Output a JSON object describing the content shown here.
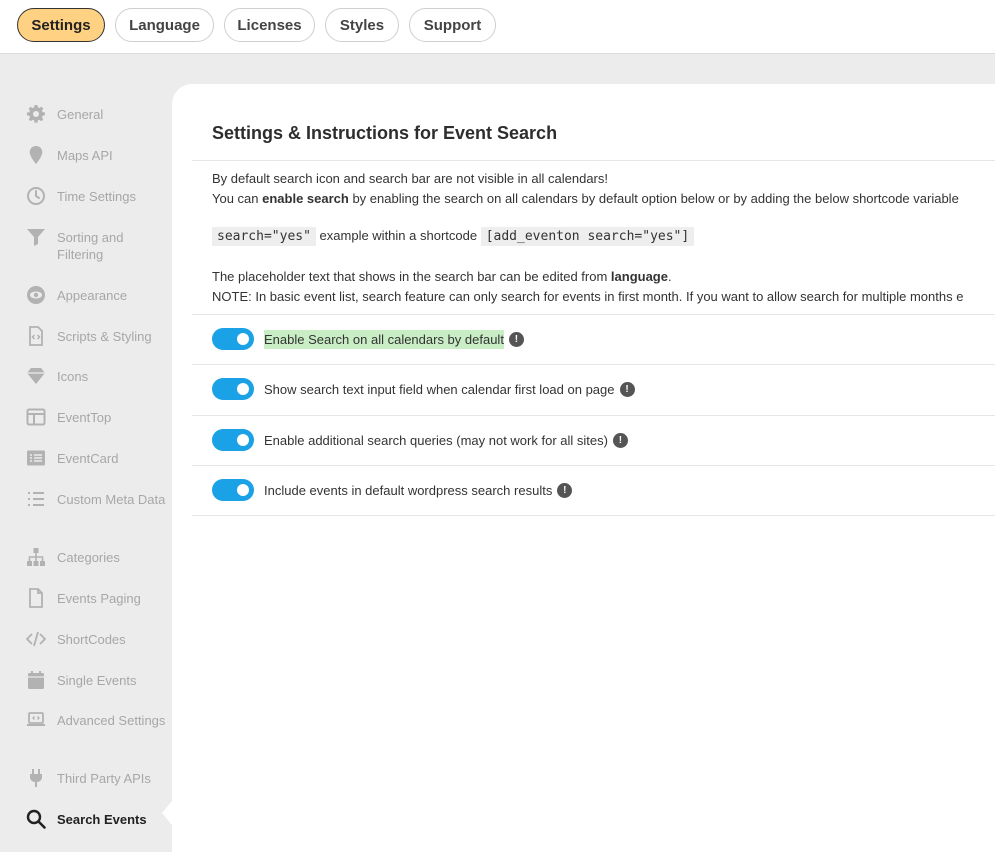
{
  "top_tabs": [
    {
      "label": "Settings",
      "active": true
    },
    {
      "label": "Language",
      "active": false
    },
    {
      "label": "Licenses",
      "active": false
    },
    {
      "label": "Styles",
      "active": false
    },
    {
      "label": "Support",
      "active": false
    }
  ],
  "sidebar": {
    "items": [
      {
        "label": "General",
        "icon": "gear-icon"
      },
      {
        "label": "Maps API",
        "icon": "map-pin-icon"
      },
      {
        "label": "Time Settings",
        "icon": "clock-icon"
      },
      {
        "label": "Sorting and Filtering",
        "icon": "filter-icon"
      },
      {
        "label": "Appearance",
        "icon": "eye-icon"
      },
      {
        "label": "Scripts & Styling",
        "icon": "code-file-icon"
      },
      {
        "label": "Icons",
        "icon": "diamond-icon"
      },
      {
        "label": "EventTop",
        "icon": "layout-icon"
      },
      {
        "label": "EventCard",
        "icon": "card-list-icon"
      },
      {
        "label": "Custom Meta Data",
        "icon": "list-icon"
      },
      {
        "label": "Categories",
        "icon": "sitemap-icon"
      },
      {
        "label": "Events Paging",
        "icon": "file-icon"
      },
      {
        "label": "ShortCodes",
        "icon": "code-icon"
      },
      {
        "label": "Single Events",
        "icon": "calendar-icon"
      },
      {
        "label": "Advanced Settings",
        "icon": "laptop-code-icon"
      },
      {
        "label": "Third Party APIs",
        "icon": "plug-icon"
      },
      {
        "label": "Search Events",
        "icon": "search-icon",
        "active": true
      }
    ]
  },
  "main": {
    "title": "Settings & Instructions for Event Search",
    "intro_line1": "By default search icon and search bar are not visible in all calendars!",
    "intro_line2_pre": "You can ",
    "intro_line2_bold": "enable search",
    "intro_line2_post": " by enabling the search on all calendars by default option below or by adding the below shortcode variable",
    "code1": "search=\"yes\"",
    "code_between": "example within a shortcode",
    "code2": "[add_eventon search=\"yes\"]",
    "placeholder_pre": "The placeholder text that shows in the search bar can be edited from ",
    "placeholder_bold": "language",
    "placeholder_post": ".",
    "note": "NOTE: In basic event list, search feature can only search for events in first month. If you want to allow search for multiple months e",
    "toggles": [
      {
        "label": "Enable Search on all calendars by default",
        "on": true,
        "highlighted": true,
        "info": "!"
      },
      {
        "label": "Show search text input field when calendar first load on page",
        "on": true,
        "highlighted": false,
        "info": "!"
      },
      {
        "label": "Enable additional search queries (may not work for all sites)",
        "on": true,
        "highlighted": false,
        "info": "!"
      },
      {
        "label": "Include events in default wordpress search results",
        "on": true,
        "highlighted": false,
        "info": "!"
      }
    ]
  },
  "colors": {
    "active_tab": "#ffd182",
    "toggle_on": "#1aa1e6",
    "highlight": "#c9edc5",
    "sidebar_bg": "#ececec"
  }
}
